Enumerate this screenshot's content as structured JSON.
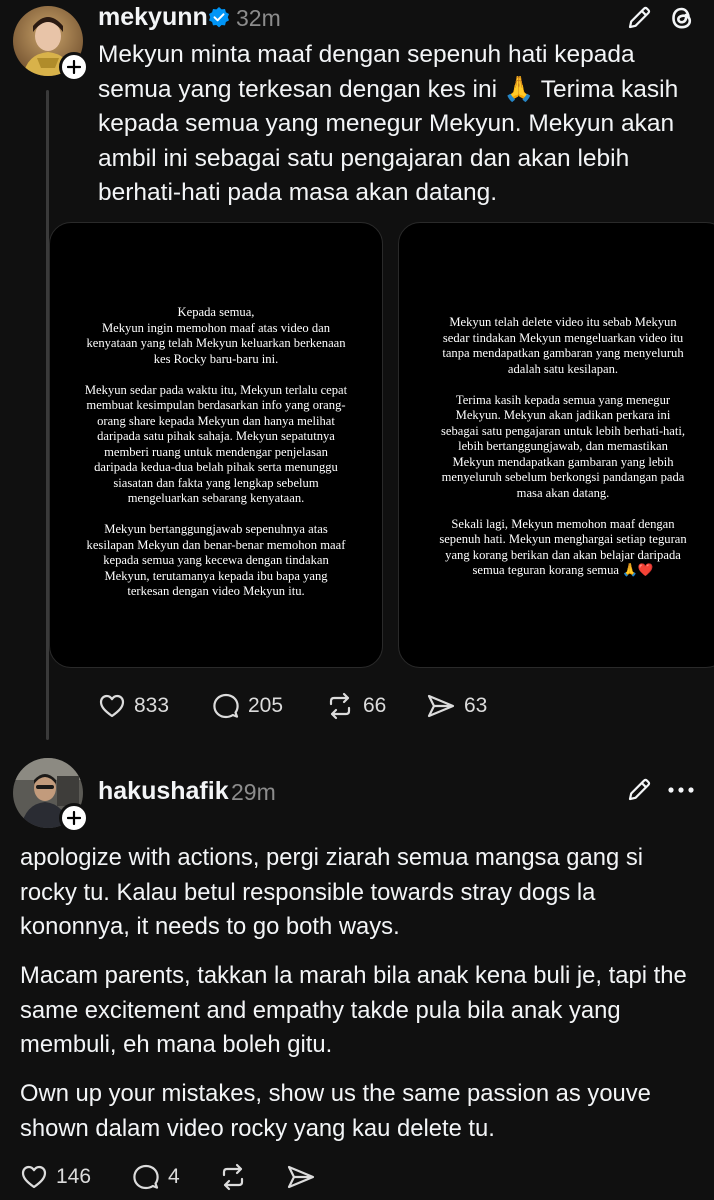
{
  "post1": {
    "username": "mekyunn",
    "time": "32m",
    "verified": true,
    "text": "Mekyun minta maaf dengan sepenuh hati kepada semua yang terkesan dengan kes ini 🙏 Terima kasih kepada semua yang menegur Mekyun. Mekyun akan ambil ini sebagai satu pengajaran dan akan lebih berhati-hati pada masa akan datang.",
    "story1": "Kepada semua,\nMekyun ingin memohon maaf atas video dan\nkenyataan yang telah Mekyun keluarkan berkenaan\nkes Rocky baru-baru ini.\n\nMekyun sedar pada waktu itu, Mekyun terlalu cepat\nmembuat kesimpulan berdasarkan info yang orang-\norang share kepada Mekyun dan hanya melihat\ndaripada satu pihak sahaja. Mekyun sepatutnya\nmemberi ruang untuk mendengar penjelasan\ndaripada kedua-dua belah pihak serta menunggu\nsiasatan dan fakta yang lengkap sebelum\nmengeluarkan sebarang kenyataan.\n\nMekyun bertanggungjawab sepenuhnya atas\nkesilapan Mekyun dan benar-benar memohon maaf\nkepada semua yang kecewa dengan tindakan\nMekyun, terutamanya kepada ibu bapa yang\nterkesan dengan video Mekyun itu.",
    "story2": "Mekyun telah delete video itu sebab Mekyun\nsedar tindakan Mekyun mengeluarkan video itu\ntanpa mendapatkan gambaran yang menyeluruh\nadalah satu kesilapan.\n\nTerima kasih kepada semua yang menegur\nMekyun. Mekyun akan jadikan perkara ini\nsebagai satu pengajaran untuk lebih berhati-hati,\nlebih bertanggungjawab, dan memastikan\nMekyun mendapatkan gambaran yang lebih\nmenyeluruh sebelum berkongsi pandangan pada\nmasa akan datang.\n\nSekali lagi, Mekyun memohon maaf dengan\nsepenuh hati. Mekyun menghargai setiap teguran\nyang korang berikan dan akan belajar daripada\nsemua teguran korang semua 🙏❤️",
    "likes": "833",
    "replies": "205",
    "reposts": "66",
    "shares": "63"
  },
  "post2": {
    "username": "hakushafik",
    "time": "29m",
    "para1": "apologize with actions, pergi ziarah semua mangsa gang si rocky tu. Kalau betul responsible towards stray dogs la kononnya, it needs to go both ways.",
    "para2": "Macam parents, takkan la marah bila anak kena buli je, tapi the same excitement and empathy takde pula bila anak yang membuli, eh mana boleh gitu.",
    "para3": "Own up your mistakes, show us the same passion as youve shown dalam video rocky yang kau delete tu.",
    "likes": "146",
    "replies": "4"
  },
  "icons": {
    "edit": "pencil-icon",
    "threads": "threads-logo-icon",
    "more": "more-icon",
    "like": "heart-icon",
    "reply": "comment-icon",
    "repost": "repost-icon",
    "share": "send-icon"
  },
  "colors": {
    "background": "#101010",
    "text": "#f3f5f7",
    "muted": "#8c8c8c",
    "verified": "#0095f6"
  }
}
